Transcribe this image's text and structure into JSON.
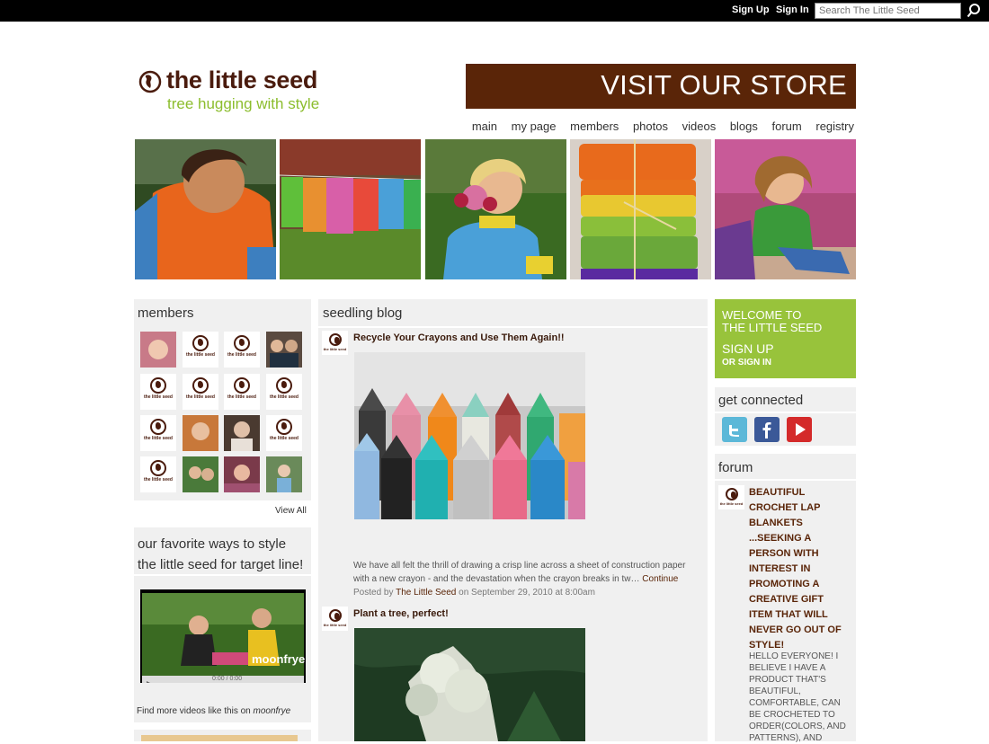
{
  "topbar": {
    "signup": "Sign Up",
    "signin": "Sign In",
    "search_placeholder": "Search The Little Seed"
  },
  "brand": {
    "title": "the little seed",
    "tagline": "tree hugging with style",
    "store_banner": "VISIT OUR STORE"
  },
  "nav": [
    "main",
    "my page",
    "members",
    "photos",
    "videos",
    "blogs",
    "forum",
    "registry"
  ],
  "members": {
    "title": "members",
    "avatar_caption": "the little seed",
    "view_all": "View All"
  },
  "video": {
    "title": "our favorite ways to style the little seed for target line!",
    "watermark": "moonfrye",
    "time": "0:00 / 0:00",
    "find_more": "Find more videos like this on",
    "find_more_site": "moonfrye"
  },
  "blog": {
    "title": "seedling blog",
    "posts": [
      {
        "title": "Recycle Your Crayons and Use Them Again!!",
        "excerpt_line1": "We have all felt the thrill of drawing a crisp line across a sheet of construction paper",
        "excerpt_line2": "with a new crayon - and the devastation when the crayon breaks in tw…",
        "continue": "Continue",
        "posted_by": "Posted by",
        "author": "The Little Seed",
        "on": "on",
        "date": "September 29, 2010 at 8:00am"
      },
      {
        "title": "Plant a tree, perfect!"
      }
    ]
  },
  "welcome": {
    "line1": "WELCOME TO",
    "line2": "THE LITTLE SEED",
    "signup": "SIGN UP",
    "signin": "OR SIGN IN"
  },
  "connected": {
    "title": "get connected"
  },
  "forum": {
    "title": "forum",
    "post_title": "BEAUTIFUL CROCHET LAP BLANKETS ...SEEKING A PERSON WITH INTEREST IN PROMOTING A CREATIVE GIFT ITEM THAT WILL NEVER GO OUT OF STYLE!",
    "post_body": "HELLO EVERYONE! I BELIEVE I HAVE A PRODUCT THAT'S BEAUTIFUL, COMFORTABLE, CAN BE CROCHETED TO ORDER(COLORS, AND PATTERNS), AND"
  },
  "colors": {
    "brand_brown": "#5a2508",
    "brand_green": "#98c33b",
    "panel_gray": "#f0f0f0"
  }
}
